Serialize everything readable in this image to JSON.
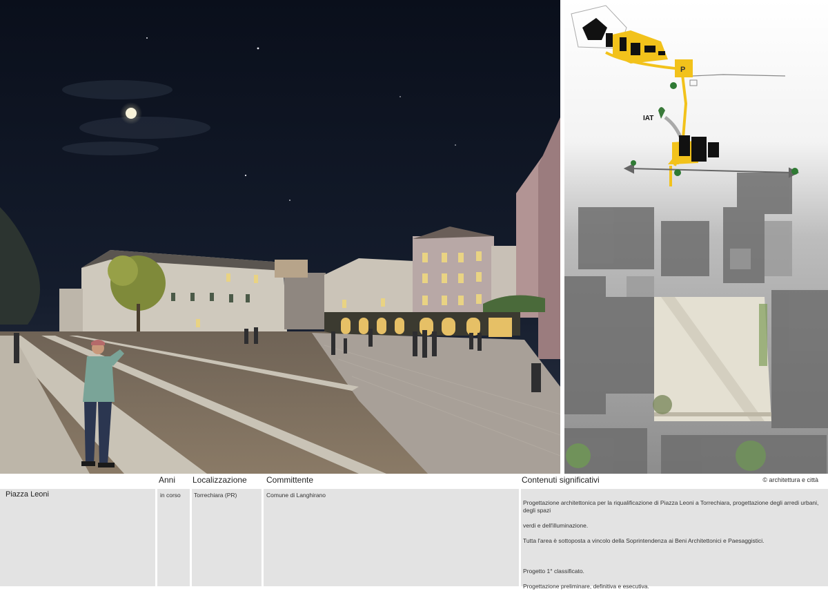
{
  "plan": {
    "iat_label": "IAT",
    "parking_label": "P"
  },
  "info": {
    "headers": {
      "anni": "Anni",
      "localizzazione": "Localizzazione",
      "committente": "Committente",
      "contenuti": "Contenuti significativi"
    },
    "credit": "© architettura e città",
    "project_name": "Piazza Leoni",
    "anni": "in corso",
    "localizzazione": "Torrechiara (PR)",
    "committente": "Comune di Langhirano",
    "contenuti_lines": [
      "Progettazione architettonica per la riqualificazione di Piazza Leoni a Torrechiara, progettazione degli arredi urbani, degli spazi",
      "verdi e dell'illuminazione.",
      "Tutta l'area è sottoposta a vincolo della Soprintendenza ai Beni Architettonici e Paesaggistici.",
      "",
      "Progetto 1° classificato.",
      "Progettazione preliminare, definitiva e esecutiva."
    ]
  },
  "colors": {
    "accent_yellow": "#f2c21b",
    "sky": "#0d1422",
    "panel_gray": "#e3e3e3"
  }
}
